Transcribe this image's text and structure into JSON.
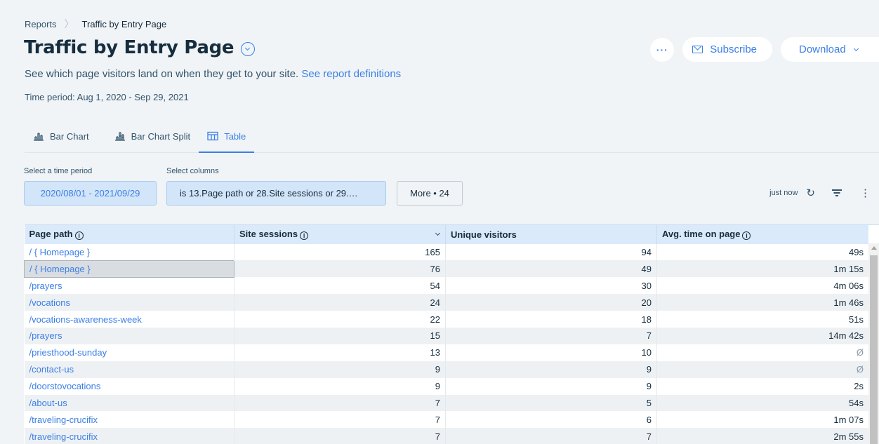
{
  "breadcrumb": {
    "parent": "Reports",
    "current": "Traffic by Entry Page"
  },
  "header": {
    "title": "Traffic by Entry Page",
    "more_label": "···",
    "subscribe_label": "Subscribe",
    "download_label": "Download"
  },
  "subtitle": {
    "text": "See which page visitors land on when they get to your site.",
    "link": "See report definitions"
  },
  "time_period": "Time period: Aug 1, 2020 - Sep 29, 2021",
  "tabs": [
    {
      "label": "Bar Chart",
      "icon": "bar-chart-icon",
      "active": false
    },
    {
      "label": "Bar Chart Split",
      "icon": "bar-chart-split-icon",
      "active": false
    },
    {
      "label": "Table",
      "icon": "table-icon",
      "active": true
    }
  ],
  "filters": {
    "time_label": "Select a time period",
    "time_value": "2020/08/01 - 2021/09/29",
    "columns_label": "Select columns",
    "columns_value": "is 13.Page path or 28.Site sessions or 29.…",
    "more_label": "More • 24"
  },
  "refresh": {
    "status": "just now"
  },
  "table": {
    "columns": [
      "Page path",
      "Site sessions",
      "Unique visitors",
      "Avg. time on page"
    ],
    "rows": [
      [
        "/ { Homepage }",
        "165",
        "94",
        "49s"
      ],
      [
        "/ { Homepage }",
        "76",
        "49",
        "1m 15s"
      ],
      [
        "/prayers",
        "54",
        "30",
        "4m 06s"
      ],
      [
        "/vocations",
        "24",
        "20",
        "1m 46s"
      ],
      [
        "/vocations-awareness-week",
        "22",
        "18",
        "51s"
      ],
      [
        "/prayers",
        "15",
        "7",
        "14m 42s"
      ],
      [
        "/priesthood-sunday",
        "13",
        "10",
        "Ø"
      ],
      [
        "/contact-us",
        "9",
        "9",
        "Ø"
      ],
      [
        "/doorstovocations",
        "9",
        "9",
        "2s"
      ],
      [
        "/about-us",
        "7",
        "5",
        "54s"
      ],
      [
        "/traveling-crucifix",
        "7",
        "6",
        "1m 07s"
      ],
      [
        "/traveling-crucifix",
        "7",
        "7",
        "2m 55s"
      ]
    ]
  },
  "colors": {
    "accent": "#3b7fe6",
    "header_bg": "#daeafa",
    "page_bg": "#f0f4f7"
  }
}
